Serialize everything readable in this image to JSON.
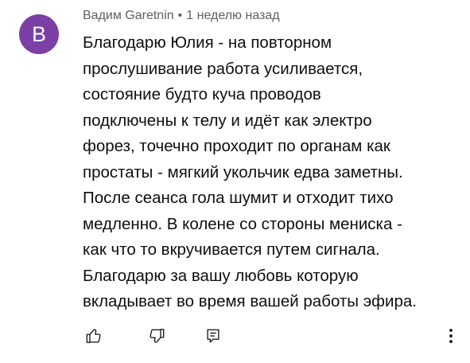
{
  "comment": {
    "author": "Вадим Garetnin",
    "separator": "•",
    "timestamp": "1 неделю назад",
    "avatar": {
      "letter": "B",
      "color": "#7b3fa6"
    },
    "text_lines": [
      "Благодарю Юлия - на повторном",
      "прослушивание работа усиливается,",
      "состояние будто куча проводов",
      "подключены к телу и идёт как электро",
      "форез, точечно проходит по органам как",
      "простаты - мягкий укольчик едва заметны.",
      "После сеанса гола шумит и отходит тихо",
      "медленно. В колене со стороны мениска -",
      "как что то вкручивается путем сигнала.",
      "Благодарю за вашу любовь которую",
      "вкладывает во время вашей работы эфира."
    ],
    "actions": {
      "like_icon": "thumbs-up-icon",
      "dislike_icon": "thumbs-down-icon",
      "reply_icon": "reply-icon",
      "more_icon": "more-vertical-icon"
    }
  }
}
